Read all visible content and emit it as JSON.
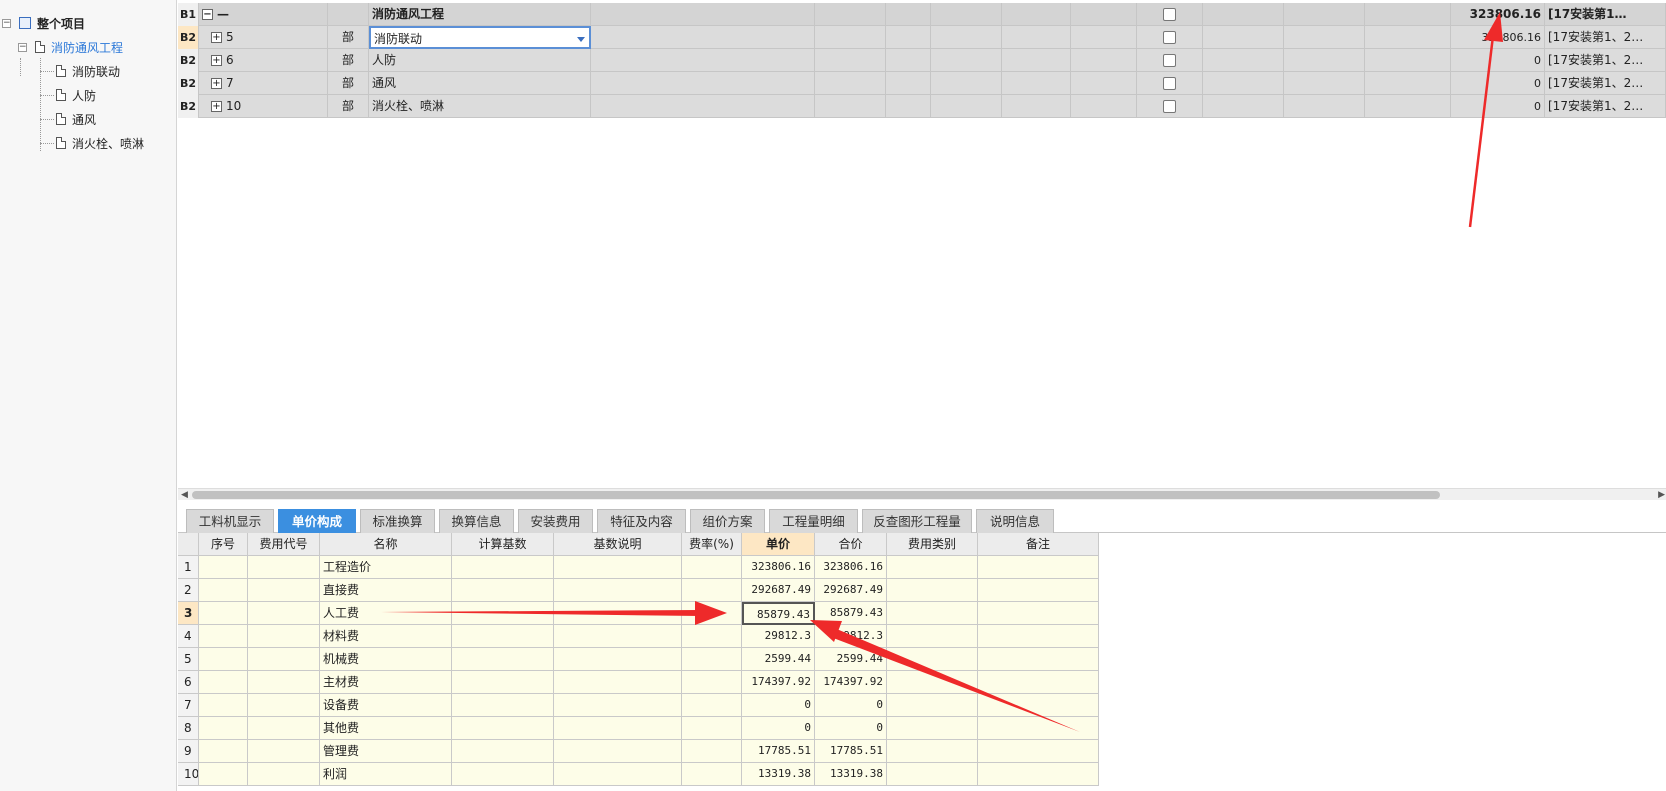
{
  "tree": {
    "root": "整个项目",
    "project": "消防通风工程",
    "children": [
      "消防联动",
      "人防",
      "通风",
      "消火栓、喷淋"
    ]
  },
  "top_rows": [
    {
      "hdr": "B1",
      "code": "—",
      "unit": "",
      "name": "消防通风工程",
      "amount": "323806.16",
      "note": "[17安装第1…"
    },
    {
      "hdr": "B2",
      "code": "5",
      "unit": "部",
      "name": "消防联动",
      "amount": "323806.16",
      "note": "[17安装第1、2…"
    },
    {
      "hdr": "B2",
      "code": "6",
      "unit": "部",
      "name": "人防",
      "amount": "0",
      "note": "[17安装第1、2…"
    },
    {
      "hdr": "B2",
      "code": "7",
      "unit": "部",
      "name": "通风",
      "amount": "0",
      "note": "[17安装第1、2…"
    },
    {
      "hdr": "B2",
      "code": "10",
      "unit": "部",
      "name": "消火栓、喷淋",
      "amount": "0",
      "note": "[17安装第1、2…"
    }
  ],
  "tabs": [
    "工料机显示",
    "单价构成",
    "标准换算",
    "换算信息",
    "安装费用",
    "特征及内容",
    "组价方案",
    "工程量明细",
    "反查图形工程量",
    "说明信息"
  ],
  "active_tab": "单价构成",
  "bottom_grid": {
    "headers": [
      "",
      "序号",
      "费用代号",
      "名称",
      "计算基数",
      "基数说明",
      "费率(%)",
      "单价",
      "合价",
      "费用类别",
      "备注"
    ],
    "rows": [
      {
        "n": "1",
        "name": "工程造价",
        "price": "323806.16",
        "total": "323806.16"
      },
      {
        "n": "2",
        "name": "直接费",
        "price": "292687.49",
        "total": "292687.49"
      },
      {
        "n": "3",
        "name": "人工费",
        "price": "85879.43",
        "total": "85879.43"
      },
      {
        "n": "4",
        "name": "材料费",
        "price": "29812.3",
        "total": "29812.3"
      },
      {
        "n": "5",
        "name": "机械费",
        "price": "2599.44",
        "total": "2599.44"
      },
      {
        "n": "6",
        "name": "主材费",
        "price": "174397.92",
        "total": "174397.92"
      },
      {
        "n": "7",
        "name": "设备费",
        "price": "0",
        "total": "0"
      },
      {
        "n": "8",
        "name": "其他费",
        "price": "0",
        "total": "0"
      },
      {
        "n": "9",
        "name": "管理费",
        "price": "17785.51",
        "total": "17785.51"
      },
      {
        "n": "10",
        "name": "利润",
        "price": "13319.38",
        "total": "13319.38"
      }
    ]
  },
  "colors": {
    "accent": "#3b8fe0",
    "arrow": "#ee2a2a",
    "row_bg": "#fdfde8"
  }
}
